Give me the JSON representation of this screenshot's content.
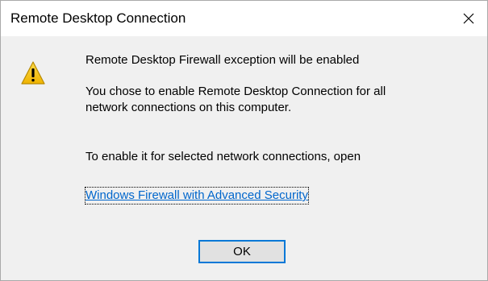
{
  "window": {
    "title": "Remote Desktop Connection"
  },
  "message": {
    "heading": "Remote Desktop Firewall exception will be enabled",
    "paragraph1": "You chose to enable Remote Desktop Connection for all network connections on this computer.",
    "paragraph2": "To enable it for selected network connections, open"
  },
  "link": {
    "label": "Windows Firewall with Advanced Security"
  },
  "buttons": {
    "ok_label": "OK"
  },
  "icons": {
    "warning": "warning-icon",
    "close": "close-icon"
  },
  "colors": {
    "link": "#0066cc",
    "button_focus_border": "#0078d7",
    "warning_fill": "#f5c211",
    "background": "#f0f0f0",
    "title_bar": "#ffffff"
  }
}
